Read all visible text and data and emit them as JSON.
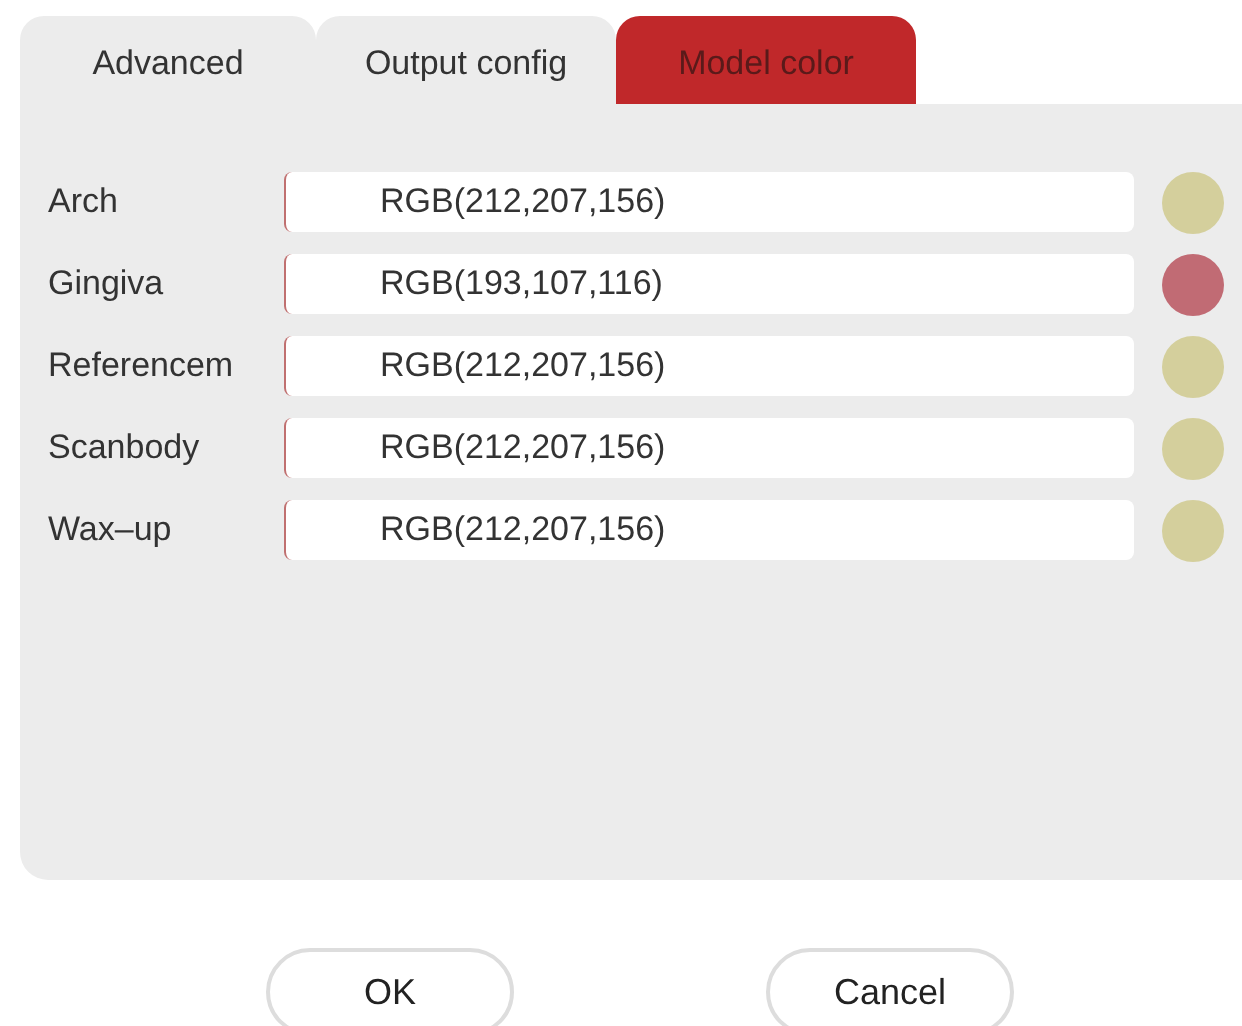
{
  "tabs": [
    {
      "label": "Advanced",
      "selected": false
    },
    {
      "label": "Output config",
      "selected": false
    },
    {
      "label": "Model color",
      "selected": true
    }
  ],
  "models": [
    {
      "name": "Arch",
      "value": "RGB(212,207,156)",
      "color": "#d4cf9c"
    },
    {
      "name": "Gingiva",
      "value": "RGB(193,107,116)",
      "color": "#c16b74"
    },
    {
      "name": "Referencem",
      "value": "RGB(212,207,156)",
      "color": "#d4cf9c"
    },
    {
      "name": "Scanbody",
      "value": "RGB(212,207,156)",
      "color": "#d4cf9c"
    },
    {
      "name": "Wax–up",
      "value": "RGB(212,207,156)",
      "color": "#d4cf9c"
    }
  ],
  "buttons": [
    "OK",
    "Cancel"
  ]
}
